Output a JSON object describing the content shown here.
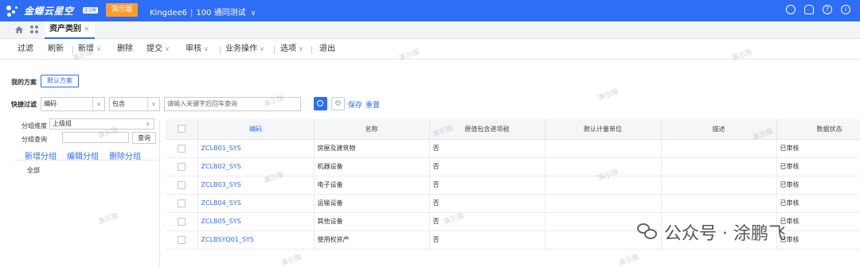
{
  "header": {
    "brand": "金蝶云星空",
    "brand_badge": "企业版",
    "demo_label": "演示版",
    "tenant": "Kingdee6",
    "org": "100 通同测试",
    "icons": [
      "search-icon",
      "bell-icon",
      "help-icon",
      "power-icon"
    ]
  },
  "tabs": [
    {
      "label": "资产类别",
      "active": true
    }
  ],
  "toolbar": {
    "items": [
      {
        "label": "过滤",
        "dropdown": false
      },
      {
        "label": "刷新",
        "dropdown": false
      },
      {
        "label": "新增",
        "dropdown": true
      },
      {
        "label": "删除",
        "dropdown": false
      },
      {
        "label": "提交",
        "dropdown": true
      },
      {
        "label": "审核",
        "dropdown": true
      },
      {
        "label": "业务操作",
        "dropdown": true
      },
      {
        "label": "选项",
        "dropdown": true
      },
      {
        "label": "退出",
        "dropdown": false
      }
    ]
  },
  "scheme": {
    "label": "我的方案",
    "default_button": "默认方案"
  },
  "quick_filter": {
    "label": "快捷过滤",
    "field": "编码",
    "operator": "包含",
    "placeholder": "请输入关键字后回车查询",
    "save": "保存",
    "reset": "重置"
  },
  "group_panel": {
    "dimension_label": "分组维度",
    "dimension_value": "上级组",
    "query_label": "分组查询",
    "query_button": "查询",
    "add_group": "新增分组",
    "edit_group": "编辑分组",
    "delete_group": "删除分组",
    "tree_root": "全部"
  },
  "grid": {
    "columns": [
      "编码",
      "名称",
      "原值包含进项税",
      "默认计量单位",
      "描述",
      "数据状态"
    ],
    "rows": [
      {
        "code": "ZCLB01_SYS",
        "name": "房屋及建筑物",
        "tax": "否",
        "unit": "",
        "desc": "",
        "status": "已审核"
      },
      {
        "code": "ZCLB02_SYS",
        "name": "机器设备",
        "tax": "否",
        "unit": "",
        "desc": "",
        "status": "已审核"
      },
      {
        "code": "ZCLB03_SYS",
        "name": "电子设备",
        "tax": "否",
        "unit": "",
        "desc": "",
        "status": "已审核"
      },
      {
        "code": "ZCLB04_SYS",
        "name": "运输设备",
        "tax": "否",
        "unit": "",
        "desc": "",
        "status": "已审核"
      },
      {
        "code": "ZCLB05_SYS",
        "name": "其他设备",
        "tax": "否",
        "unit": "",
        "desc": "",
        "status": "已审核"
      },
      {
        "code": "ZCLBSYQ01_SYS",
        "name": "使用权资产",
        "tax": "否",
        "unit": "",
        "desc": "",
        "status": "已审核"
      }
    ]
  },
  "watermark": "演示版",
  "wechat_caption": "公众号 · 涂鹏飞",
  "colors": {
    "primary": "#2e6df5",
    "demo_orange": "#ff9c2b"
  }
}
